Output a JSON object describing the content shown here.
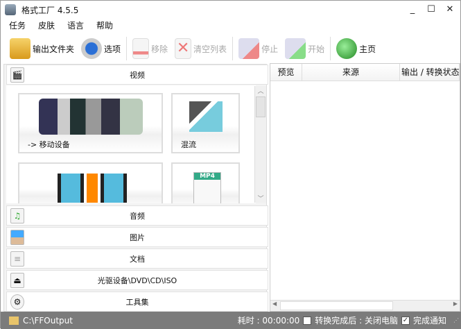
{
  "window": {
    "title": "格式工厂 4.5.5",
    "minimize": "_",
    "maximize": "☐",
    "close": "✕"
  },
  "menu": [
    "任务",
    "皮肤",
    "语言",
    "帮助"
  ],
  "toolbar": {
    "output_folder": "输出文件夹",
    "options": "选项",
    "remove": "移除",
    "clear_list": "清空列表",
    "stop": "停止",
    "start": "开始",
    "home": "主页"
  },
  "left": {
    "video": "视频",
    "tiles": {
      "mobile": "-> 移动设备",
      "mux": "混流",
      "mp4_badge": "MP4"
    },
    "categories": {
      "audio": "音频",
      "picture": "图片",
      "document": "文档",
      "rom": "光驱设备\\DVD\\CD\\ISO",
      "tools": "工具集"
    }
  },
  "task_list": {
    "columns": [
      "预览",
      "来源",
      "输出 / 转换状态"
    ]
  },
  "status": {
    "output_path": "C:\\FFOutput",
    "elapsed": "耗时 : 00:00:00",
    "shutdown_label": "转换完成后 : 关闭电脑",
    "shutdown_checked": false,
    "notify_label": "完成通知",
    "notify_checked": true,
    "check_mark": "✓"
  }
}
